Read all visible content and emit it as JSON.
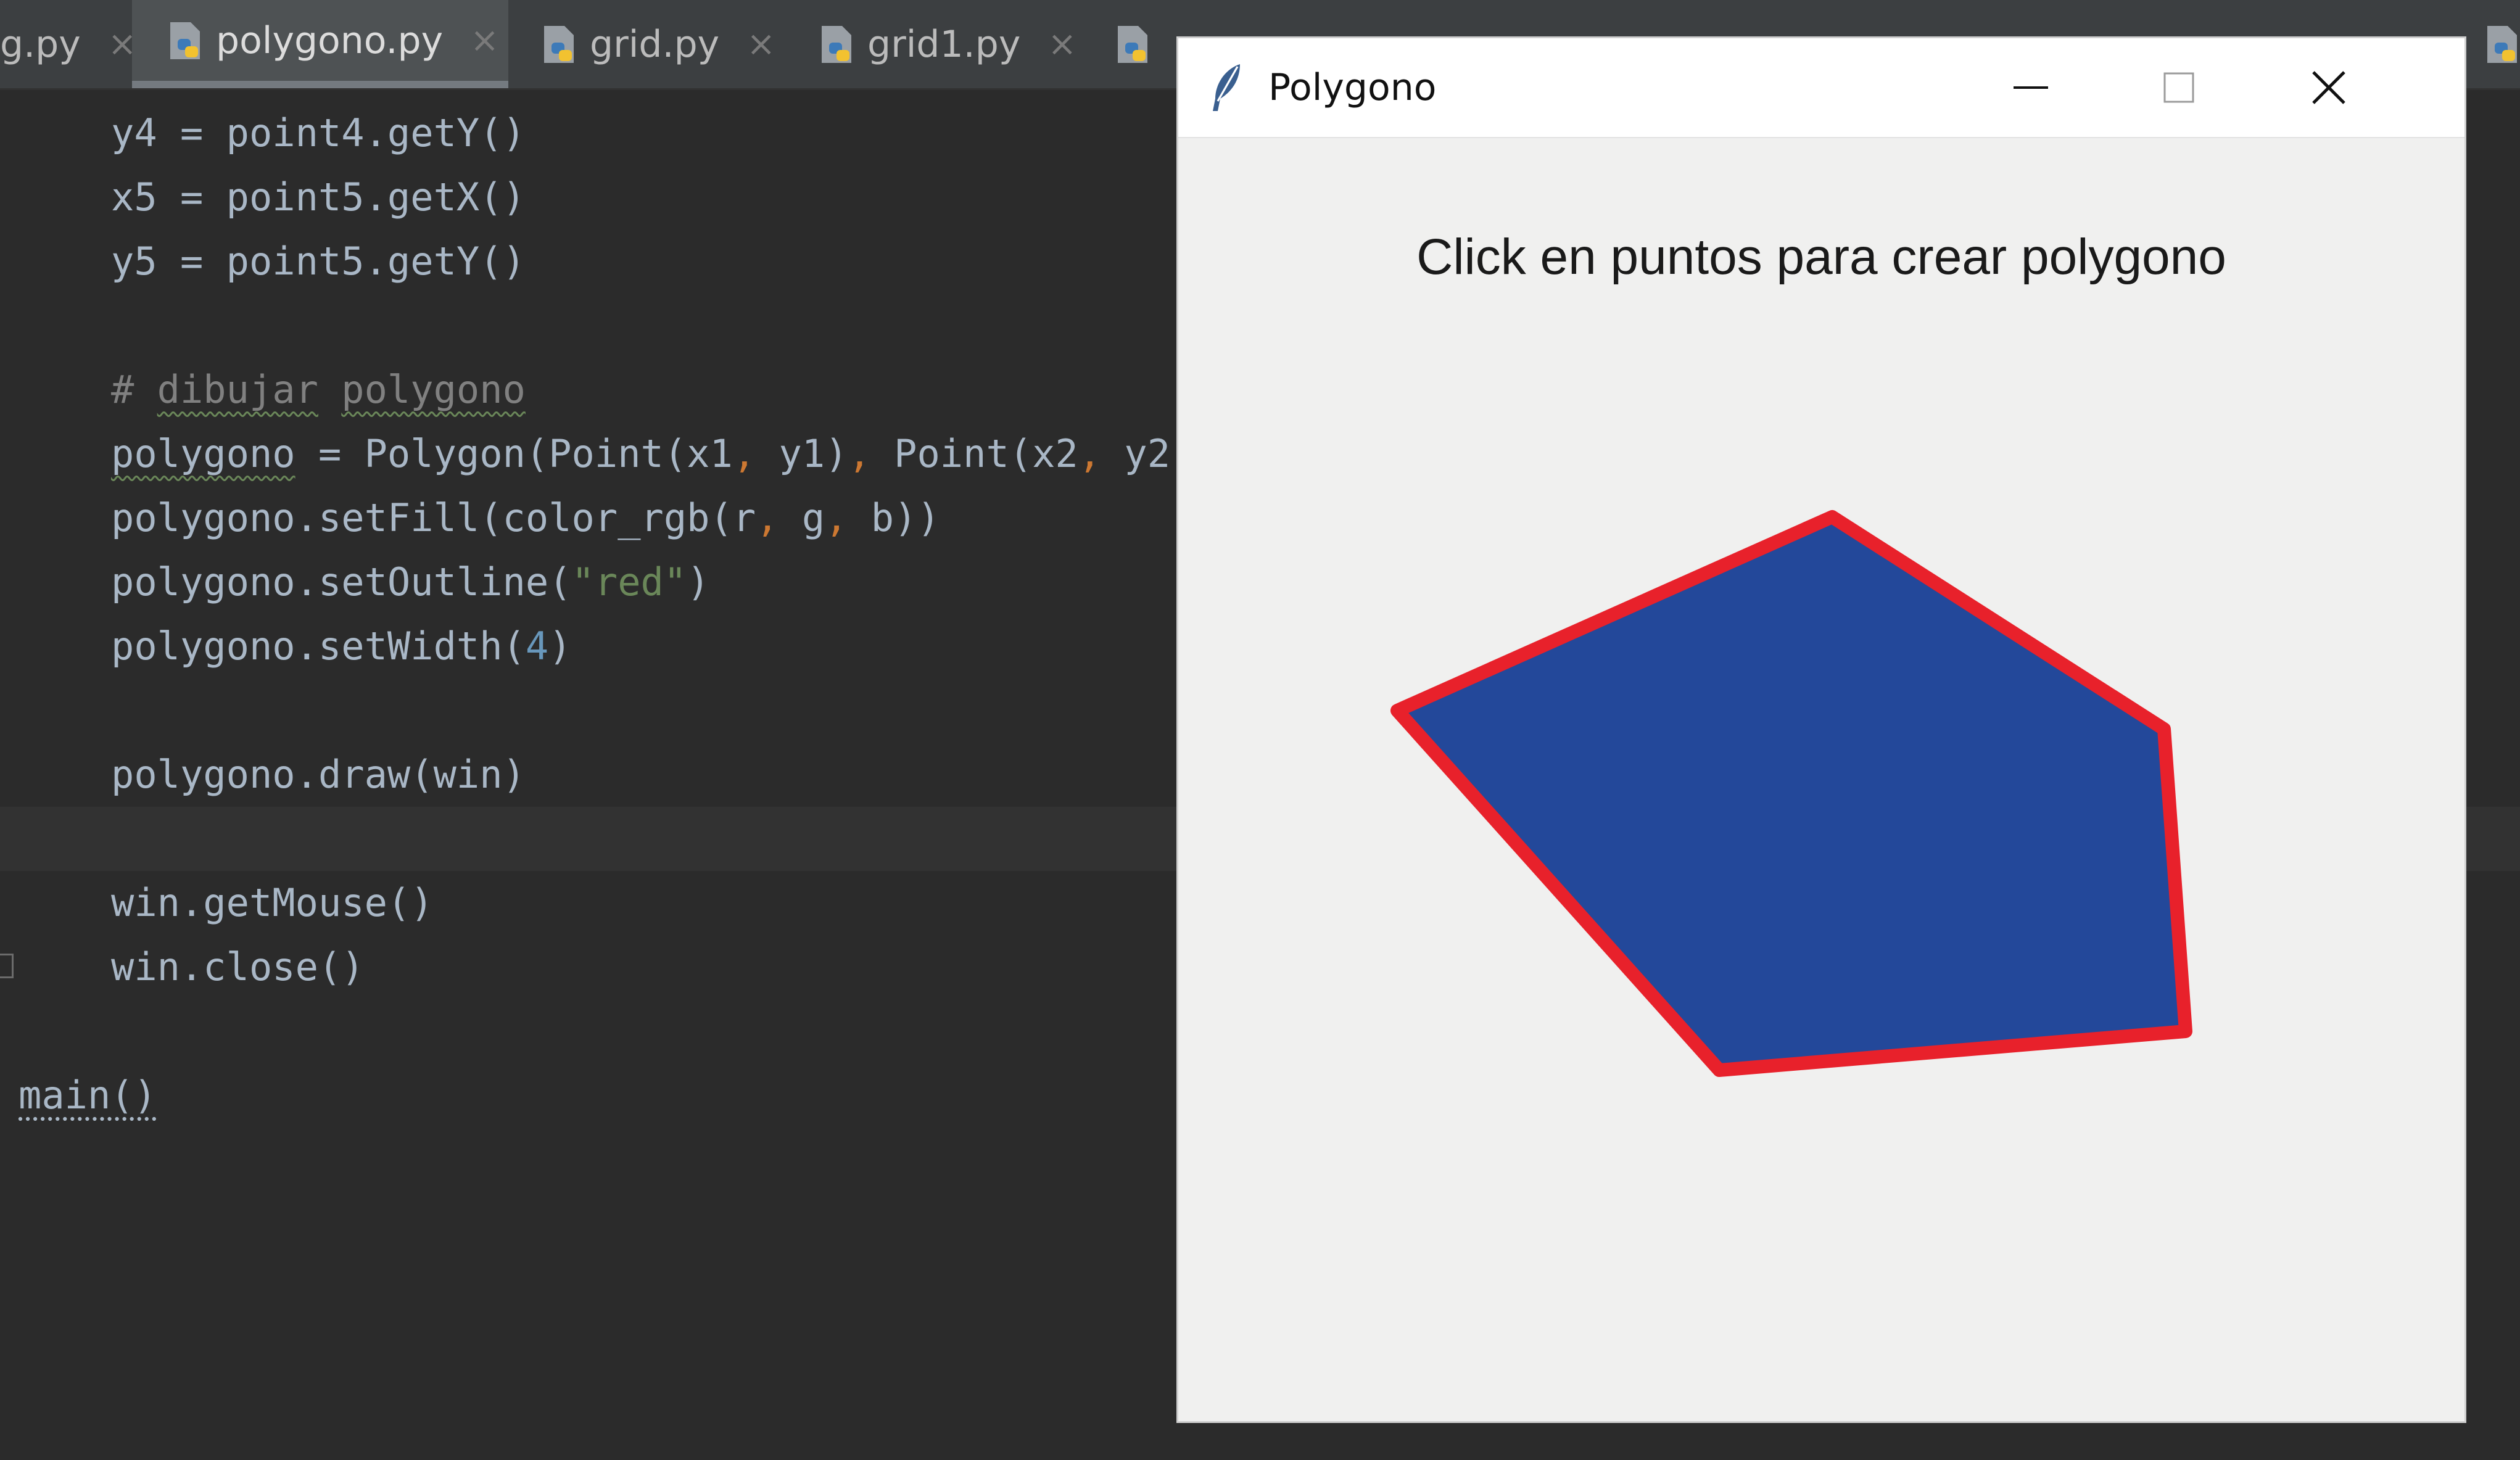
{
  "tabs": [
    {
      "label": "g.py",
      "close": "×"
    },
    {
      "label": "polygono.py",
      "close": "×",
      "active": true
    },
    {
      "label": "grid.py",
      "close": "×"
    },
    {
      "label": "grid1.py",
      "close": "×"
    }
  ],
  "code": {
    "line1": {
      "a": "y4 = point4.getY()"
    },
    "line2": {
      "a": "x5 = point5.getX()"
    },
    "line3": {
      "a": "y5 = point5.getY()"
    },
    "line4": {
      "hash": "# ",
      "w1": "dibujar",
      "sp": " ",
      "w2": "polygono"
    },
    "line5": {
      "var": "polygono",
      "a": " = Polygon(Point(x1",
      "c1": ",",
      "b": " y1)",
      "c2": ",",
      "d": " Point(x2",
      "c3": ",",
      "e": " y2"
    },
    "line6": {
      "a": "polygono.setFill(color_rgb(r",
      "c1": ",",
      "b": " g",
      "c2": ",",
      "d": " b))"
    },
    "line7": {
      "a": "polygono.setOutline(",
      "s": "\"red\"",
      "b": ")"
    },
    "line8": {
      "a": "polygono.setWidth(",
      "n": "4",
      "b": ")"
    },
    "line9": {
      "a": "polygono.draw(win)"
    },
    "line10": {
      "a": "win.getMouse()"
    },
    "line11": {
      "a": "win.close()"
    },
    "line12": {
      "a": "main()"
    }
  },
  "window": {
    "title": "Polygono",
    "heading": "Click en puntos para crear polygono",
    "icons": {
      "app": "feather-icon",
      "minimize": "minimize-icon",
      "maximize": "maximize-icon",
      "close": "close-icon"
    }
  },
  "colors": {
    "polygon_fill": "#23489a",
    "polygon_outline": "#e8212b",
    "editor_bg": "#2b2b2b",
    "window_bg": "#f0f0ef"
  }
}
